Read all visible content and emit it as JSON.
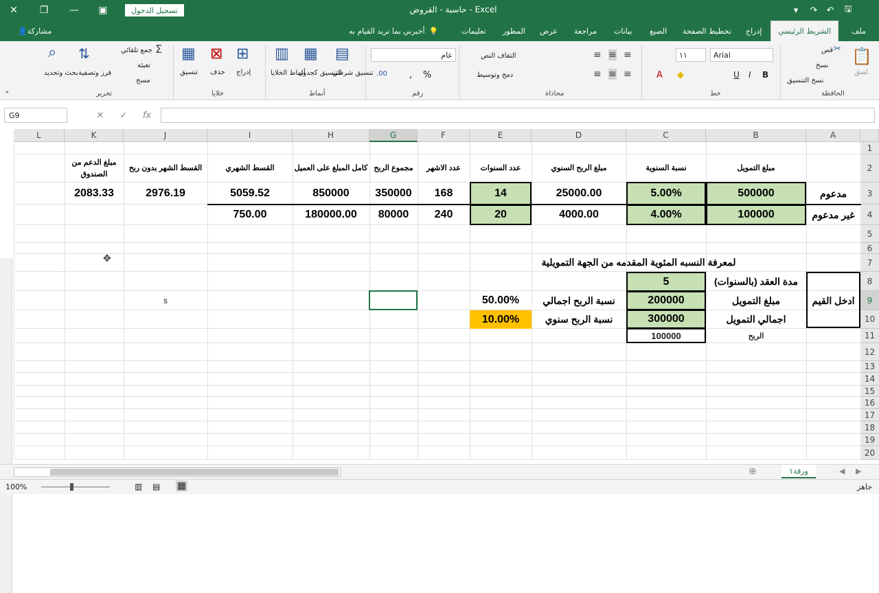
{
  "window": {
    "title": "حاسبة - القروض  -  Excel",
    "signin": "تسجيل الدخول",
    "accent": "#217346"
  },
  "tabs": {
    "file": "ملف",
    "home": "الشريط الرئيسي",
    "insert": "إدراج",
    "layout": "تخطيط الصفحة",
    "formulas": "الصيغ",
    "data": "بيانات",
    "review": "مراجعة",
    "view": "عرض",
    "developer": "المطور",
    "help": "تعليمات",
    "tellme": "أخبرني بما تريد القيام به",
    "share": "مشاركة"
  },
  "ribbon": {
    "clipboard": {
      "label": "الحافظة",
      "paste": "لصق",
      "cut": "قص",
      "copy": "نسخ",
      "format_painter": "نسخ التنسيق"
    },
    "font": {
      "label": "خط",
      "name": "Arial",
      "size": "١١"
    },
    "alignment": {
      "label": "محاذاة",
      "wrap": "التفاف النص",
      "merge": "دمج وتوسيط"
    },
    "number": {
      "label": "رقم",
      "format": "عام",
      "percent": "%"
    },
    "styles": {
      "label": "أنماط",
      "conditional": "تنسيق شرطي",
      "as_table": "التنسيق كجدول",
      "cell_styles": "أنماط الخلايا"
    },
    "cells": {
      "label": "خلايا",
      "insert": "إدراج",
      "delete": "حذف",
      "format": "تنسيق"
    },
    "editing": {
      "label": "تحرير",
      "autosum": "جمع تلقائي",
      "fill": "تعبئة",
      "clear": "مسح",
      "sort": "فرز وتصفية",
      "find": "بحث وتحديد"
    }
  },
  "formula_bar": {
    "name_box": "G9",
    "content": ""
  },
  "columns": [
    "A",
    "B",
    "C",
    "D",
    "E",
    "F",
    "G",
    "H",
    "I",
    "J",
    "K",
    "L"
  ],
  "selected_column": "G",
  "rows": [
    "1",
    "2",
    "3",
    "4",
    "5",
    "6",
    "7",
    "8",
    "9",
    "10",
    "11",
    "12",
    "13",
    "14",
    "15",
    "16",
    "17",
    "18",
    "19",
    "20"
  ],
  "selected_row": "9",
  "headers_row2": {
    "B": "مبلغ التمويل",
    "C": "نسبة السنوية",
    "D": "مبلغ الربح السنوي",
    "E": "عدد السنوات",
    "F": "عدد الاشهر",
    "G": "مجموع الربح",
    "H": "كامل المبلغ على العميل",
    "I": "القسط الشهري",
    "J": "القسط الشهر بدون ربح",
    "K": "مبلغ الدعم من الصندوق"
  },
  "row3": {
    "A": "مدعوم",
    "B": "500000",
    "C": "5.00%",
    "D": "25000.00",
    "E": "14",
    "F": "168",
    "G": "350000",
    "H": "850000",
    "I": "5059.52",
    "J": "2976.19",
    "K": "2083.33"
  },
  "row4": {
    "A": "غير مدعوم",
    "B": "100000",
    "C": "4.00%",
    "D": "4000.00",
    "E": "20",
    "F": "240",
    "G": "80000",
    "H": "180000.00",
    "I": "750.00"
  },
  "section": {
    "title": "لمعرفة النسبه المئوية المقدمه من الجهة التمويلية",
    "enter_values": "ادخل القيم",
    "contract_label": "مدة العقد (بالسنوات)",
    "contract_value": "5",
    "funding_label": "مبلغ التمويل",
    "funding_value": "200000",
    "total_label": "اجمالي التمويل",
    "total_value": "300000",
    "profit_label": "الربح",
    "profit_value": "100000",
    "total_rate_label": "نسبة الربح اجمالي",
    "total_rate_value": "50.00%",
    "annual_rate_label": "نسبة الربح سنوي",
    "annual_rate_value": "10.00%",
    "j9": "s"
  },
  "sheet_tab": "ورقة١",
  "status": {
    "ready": "جاهز",
    "zoom": "100%"
  }
}
